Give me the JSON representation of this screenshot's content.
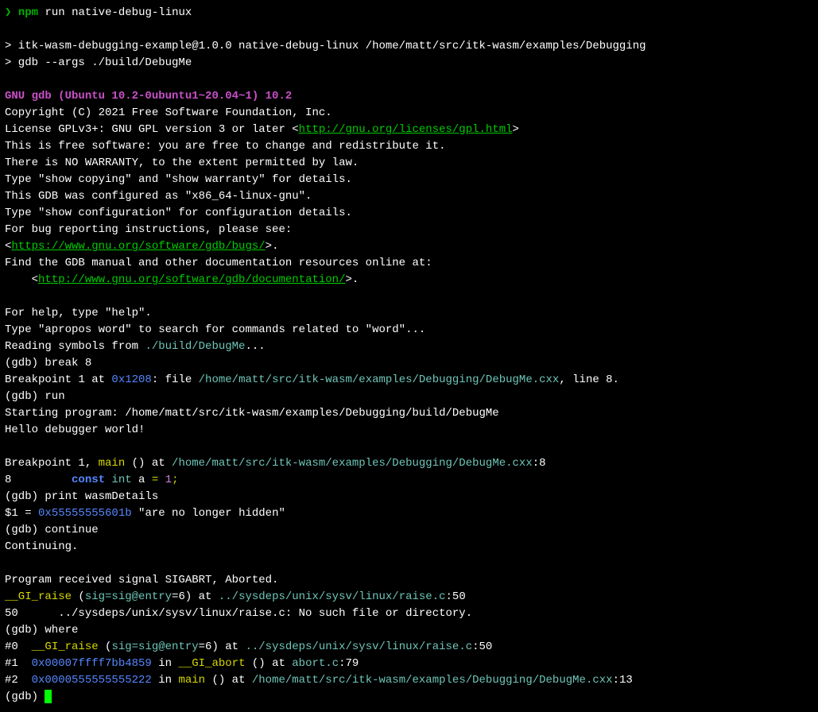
{
  "prompt_line": {
    "symbol": "❯ ",
    "npm": "npm",
    "cmd": " run native-debug-linux"
  },
  "npm_output1": "> itk-wasm-debugging-example@1.0.0 native-debug-linux /home/matt/src/itk-wasm/examples/Debugging",
  "npm_output2": "> gdb --args ./build/DebugMe",
  "gdb_version": "GNU gdb (Ubuntu 10.2-0ubuntu1~20.04~1) 10.2",
  "copyright": "Copyright (C) 2021 Free Software Foundation, Inc.",
  "license_pre": "License GPLv3+: GNU GPL version 3 or later <",
  "license_link": "http://gnu.org/licenses/gpl.html",
  "license_post": ">",
  "free_sw": "This is free software: you are free to change and redistribute it.",
  "no_warranty": "There is NO WARRANTY, to the extent permitted by law.",
  "show_copying": "Type \"show copying\" and \"show warranty\" for details.",
  "configured": "This GDB was configured as \"x86_64-linux-gnu\".",
  "show_config": "Type \"show configuration\" for configuration details.",
  "bug_report": "For bug reporting instructions, please see:",
  "bugs_pre": "<",
  "bugs_link": "https://www.gnu.org/software/gdb/bugs/",
  "bugs_post": ">.",
  "find_manual": "Find the GDB manual and other documentation resources online at:",
  "doc_pre": "    <",
  "doc_link": "http://www.gnu.org/software/gdb/documentation/",
  "doc_post": ">.",
  "help_type": "For help, type \"help\".",
  "apropos": "Type \"apropos word\" to search for commands related to \"word\"...",
  "reading_symbols_pre": "Reading symbols from ",
  "reading_symbols_path": "./build/DebugMe",
  "reading_symbols_post": "...",
  "gdb_break": "(gdb) break 8",
  "bp1_pre": "Breakpoint 1 at ",
  "bp1_addr": "0x1208",
  "bp1_mid": ": file ",
  "bp1_file": "/home/matt/src/itk-wasm/examples/Debugging/DebugMe.cxx",
  "bp1_post": ", line 8.",
  "gdb_run": "(gdb) run",
  "starting": "Starting program: /home/matt/src/itk-wasm/examples/Debugging/build/DebugMe",
  "hello": "Hello debugger world!",
  "bp1_hit_pre": "Breakpoint 1, ",
  "bp1_hit_main": "main",
  "bp1_hit_mid": " () at ",
  "bp1_hit_file": "/home/matt/src/itk-wasm/examples/Debugging/DebugMe.cxx",
  "bp1_hit_post": ":8",
  "src_line_num": "8         ",
  "src_const": "const",
  "src_int": " int",
  "src_var": " a ",
  "src_eq": "= ",
  "src_val": "1",
  "src_semi": ";",
  "gdb_print": "(gdb) print wasmDetails",
  "print_result_pre": "$1 = ",
  "print_result_addr": "0x55555555601b",
  "print_result_val": " \"are no longer hidden\"",
  "gdb_continue": "(gdb) continue",
  "continuing": "Continuing.",
  "sigabrt": "Program received signal SIGABRT, Aborted.",
  "raise_fn": "__GI_raise",
  "raise_paren_open": " (",
  "raise_sig": "sig=sig@entry",
  "raise_eq": "=6) at ",
  "raise_file": "../sysdeps/unix/sysv/linux/raise.c",
  "raise_line": ":50",
  "no_file": "50      ../sysdeps/unix/sysv/linux/raise.c: No such file or directory.",
  "gdb_where": "(gdb) where",
  "frame0_num": "#0  ",
  "frame0_fn": "__GI_raise",
  "frame0_paren": " (",
  "frame0_sig": "sig=sig@entry",
  "frame0_eq": "=6) at ",
  "frame0_file": "../sysdeps/unix/sysv/linux/raise.c",
  "frame0_line": ":50",
  "frame1_num": "#1  ",
  "frame1_addr": "0x00007ffff7bb4859",
  "frame1_in": " in ",
  "frame1_fn": "__GI_abort",
  "frame1_at": " () at ",
  "frame1_file": "abort.c",
  "frame1_line": ":79",
  "frame2_num": "#2  ",
  "frame2_addr": "0x0000555555555222",
  "frame2_in": " in ",
  "frame2_fn": "main",
  "frame2_at": " () at ",
  "frame2_file": "/home/matt/src/itk-wasm/examples/Debugging/DebugMe.cxx",
  "frame2_line": ":13",
  "gdb_prompt": "(gdb) "
}
